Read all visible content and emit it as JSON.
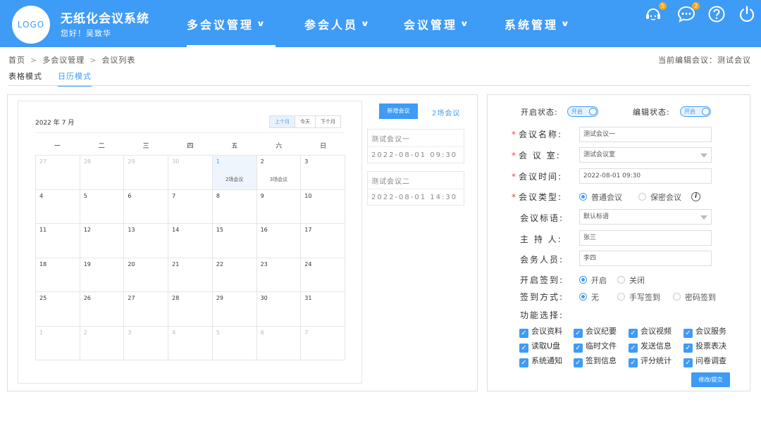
{
  "header": {
    "logo_text": "LOGO",
    "app_title": "无纸化会议系统",
    "greeting": "您好！吴致华",
    "nav": [
      {
        "label": "多会议管理"
      },
      {
        "label": "参会人员"
      },
      {
        "label": "会议管理"
      },
      {
        "label": "系统管理"
      }
    ],
    "icons": [
      {
        "name": "support-icon",
        "badge": "5"
      },
      {
        "name": "message-icon",
        "badge": "2"
      },
      {
        "name": "help-icon",
        "badge": ""
      },
      {
        "name": "power-icon",
        "badge": ""
      }
    ]
  },
  "breadcrumb": {
    "items": [
      "首页",
      "多会议管理",
      "会议列表"
    ],
    "separator": ">"
  },
  "current_meeting": "当前编辑会议：测试会议",
  "view_tabs": [
    {
      "label": "表格模式"
    },
    {
      "label": "日历模式"
    }
  ],
  "calendar": {
    "title": "2022 年 7 月",
    "buttons": [
      "上个月",
      "今天",
      "下个月"
    ],
    "weekdays": [
      "一",
      "二",
      "三",
      "四",
      "五",
      "六",
      "日"
    ],
    "days": [
      {
        "d": "27",
        "o": true
      },
      {
        "d": "28",
        "o": true
      },
      {
        "d": "29",
        "o": true
      },
      {
        "d": "30",
        "o": true
      },
      {
        "d": "1",
        "today": true,
        "ev": "2场会议"
      },
      {
        "d": "2",
        "ev": "3场会议"
      },
      {
        "d": "3"
      },
      {
        "d": "4"
      },
      {
        "d": "5"
      },
      {
        "d": "6"
      },
      {
        "d": "7"
      },
      {
        "d": "8"
      },
      {
        "d": "9"
      },
      {
        "d": "10"
      },
      {
        "d": "11"
      },
      {
        "d": "12"
      },
      {
        "d": "13"
      },
      {
        "d": "14"
      },
      {
        "d": "15"
      },
      {
        "d": "16"
      },
      {
        "d": "17"
      },
      {
        "d": "18"
      },
      {
        "d": "19"
      },
      {
        "d": "20"
      },
      {
        "d": "21"
      },
      {
        "d": "22"
      },
      {
        "d": "23"
      },
      {
        "d": "24"
      },
      {
        "d": "25"
      },
      {
        "d": "26"
      },
      {
        "d": "27"
      },
      {
        "d": "28"
      },
      {
        "d": "29"
      },
      {
        "d": "30"
      },
      {
        "d": "31"
      },
      {
        "d": "1",
        "o": true
      },
      {
        "d": "2",
        "o": true
      },
      {
        "d": "3",
        "o": true
      },
      {
        "d": "4",
        "o": true
      },
      {
        "d": "5",
        "o": true
      },
      {
        "d": "6",
        "o": true
      },
      {
        "d": "7",
        "o": true
      }
    ]
  },
  "meeting_list": {
    "add_button": "新增会议",
    "count": "2场会议",
    "items": [
      {
        "name": "测试会议一",
        "time": "2022-08-01 09:30"
      },
      {
        "name": "测试会议二",
        "time": "2022-08-01 14:30"
      }
    ]
  },
  "form": {
    "open_status_label": "开启状态:",
    "open_status_value": "开启",
    "edit_status_label": "编辑状态:",
    "edit_status_value": "开启",
    "name_label": "会议名称:",
    "name_value": "测试会议一",
    "room_label": "会 议 室:",
    "room_value": "测试会议室",
    "time_label": "会议时间:",
    "time_value": "2022-08-01 09:30",
    "type_label": "会议类型:",
    "type_options": [
      "普通会议",
      "保密会议"
    ],
    "slogan_label": "会议标语:",
    "slogan_value": "默认标语",
    "host_label": "主 持 人:",
    "host_value": "张三",
    "staff_label": "会务人员:",
    "staff_value": "李四",
    "signin_label": "开启签到:",
    "signin_options": [
      "开启",
      "关闭"
    ],
    "signin_mode_label": "签到方式:",
    "signin_mode_options": [
      "无",
      "手写签到",
      "密码签到"
    ],
    "func_label": "功能选择:",
    "functions": [
      "会议资料",
      "会议纪要",
      "会议视频",
      "会议服务",
      "读取U盘",
      "临时文件",
      "发送信息",
      "投票表决",
      "系统通知",
      "签到信息",
      "评分统计",
      "问卷调查"
    ],
    "submit": "修改/提交"
  },
  "colors": {
    "accent": "#3e9bf6",
    "badge": "#f5a623",
    "required": "#e74c3c"
  }
}
